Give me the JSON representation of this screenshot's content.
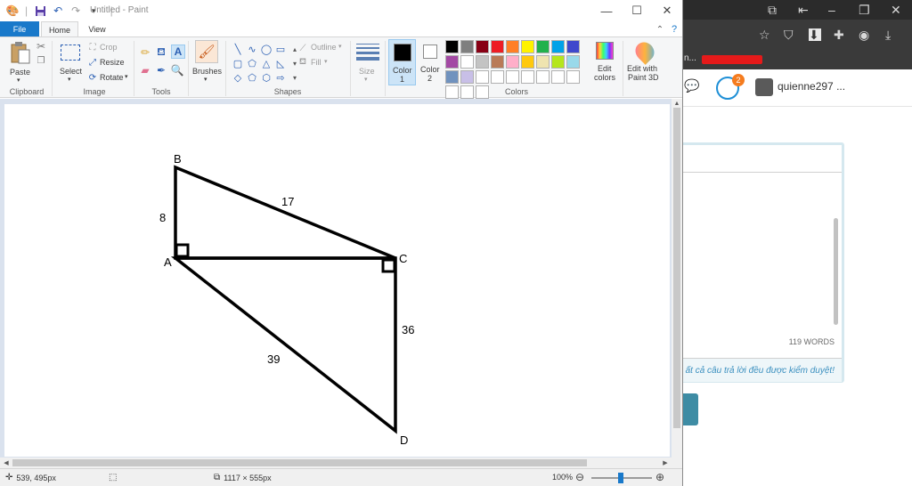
{
  "window": {
    "title": "Untitled - Paint",
    "minimize_icon": "minimize-icon",
    "maximize_icon": "maximize-icon",
    "close_icon": "close-icon"
  },
  "tabs": [
    {
      "label": "File"
    },
    {
      "label": "Home"
    },
    {
      "label": "View"
    }
  ],
  "ribbon": {
    "clipboard": {
      "label": "Clipboard",
      "paste": "Paste"
    },
    "image": {
      "label": "Image",
      "select": "Select",
      "crop": "Crop",
      "resize": "Resize",
      "rotate": "Rotate"
    },
    "tools": {
      "label": "Tools"
    },
    "brushes": {
      "label": "Brushes"
    },
    "shapes": {
      "label": "Shapes",
      "outline": "Outline",
      "fill": "Fill"
    },
    "size": {
      "label": "Size"
    },
    "color1": {
      "label": "Color",
      "num": "1",
      "value": "#000000"
    },
    "color2": {
      "label": "Color",
      "num": "2",
      "value": "#ffffff"
    },
    "colors": {
      "label": "Colors"
    },
    "edit_colors": {
      "label1": "Edit",
      "label2": "colors"
    },
    "edit_3d": {
      "label1": "Edit with",
      "label2": "Paint 3D"
    },
    "palette": [
      "#000000",
      "#7f7f7f",
      "#880015",
      "#ed1c24",
      "#ff7f27",
      "#fff200",
      "#22b14c",
      "#00a2e8",
      "#3f48cc",
      "#a349a4",
      "#ffffff",
      "#c3c3c3",
      "#b97a57",
      "#ffaec9",
      "#ffc90e",
      "#efe4b0",
      "#b5e61d",
      "#99d9ea",
      "#7092be",
      "#c8bfe7",
      "#ffffff",
      "#ffffff",
      "#ffffff",
      "#ffffff",
      "#ffffff",
      "#ffffff",
      "#ffffff",
      "#ffffff",
      "#ffffff",
      "#ffffff"
    ]
  },
  "drawing": {
    "vertices": {
      "B": "B",
      "A": "A",
      "C": "C",
      "D": "D"
    },
    "edge_labels": {
      "AB": "8",
      "BC": "17",
      "CD": "36",
      "AD": "39"
    }
  },
  "status": {
    "cursor": "539, 495px",
    "canvas_size": "1117 × 555px",
    "zoom": "100%"
  },
  "browser": {
    "username": "quienne297 ...",
    "notification_count": "2",
    "words": "119 WORDS",
    "notice": "ất cả câu trả lời đều được kiểm duyệt!",
    "bookmark_fragment": "n..."
  }
}
